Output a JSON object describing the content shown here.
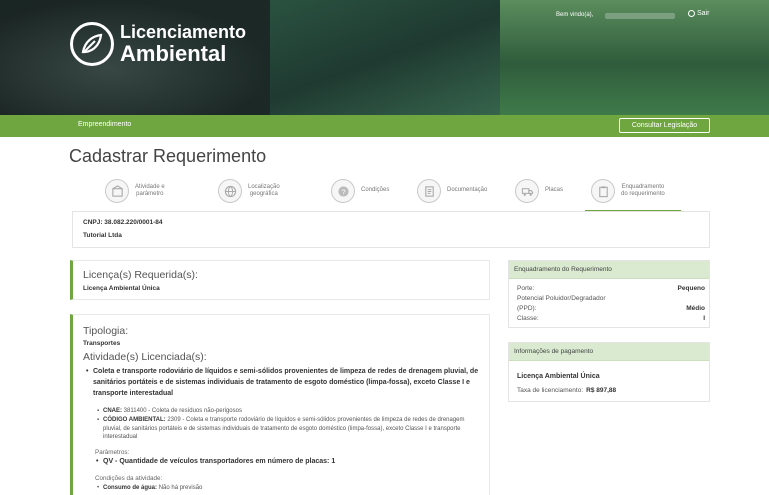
{
  "header": {
    "brand_line1": "Licenciamento",
    "brand_line2": "Ambiental",
    "welcome": "Bem vindo(a),",
    "logout": "Sair"
  },
  "nav": {
    "item": "Empreendimento",
    "consult_button": "Consultar Legislação"
  },
  "page_title": "Cadastrar Requerimento",
  "steps": [
    {
      "l1": "Atividade e",
      "l2": "parâmetro",
      "icon": "box-icon"
    },
    {
      "l1": "Localização",
      "l2": "geográfica",
      "icon": "globe-icon"
    },
    {
      "l1": "Condições",
      "l2": "",
      "icon": "question-icon"
    },
    {
      "l1": "Documentação",
      "l2": "",
      "icon": "document-icon"
    },
    {
      "l1": "Placas",
      "l2": "",
      "icon": "truck-icon"
    },
    {
      "l1": "Enquadramento",
      "l2": "do requerimento",
      "icon": "clipboard-icon"
    }
  ],
  "company": {
    "cnpj": "CNPJ: 38.082.220/0001-84",
    "name": "Tutorial Ltda"
  },
  "licenca": {
    "heading": "Licença(s) Requerida(s):",
    "value": "Licença Ambiental Única"
  },
  "tipologia": {
    "heading": "Tipologia:",
    "value": "Transportes",
    "activities_heading": "Atividade(s) Licenciada(s):",
    "activity": "Coleta e transporte rodoviário de líquidos e semi-sólidos provenientes de limpeza de redes de drenagem pluvial, de sanitários portáteis e de sistemas individuais de tratamento de esgoto doméstico (limpa-fossa), exceto Classe I e transporte interestadual",
    "cnae_label": "CNAE:",
    "cnae_value": "3811400 - Coleta de resíduos não-perigosos",
    "codigo_label": "CÓDIGO AMBIENTAL:",
    "codigo_value": "2309 - Coleta e transporte rodoviário de líquidos e semi-sólidos provenientes de limpeza de redes de drenagem pluvial, de sanitários portáteis e de sistemas individuais de tratamento de esgoto doméstico (limpa-fossa), exceto Classe I e transporte interestadual",
    "params_label": "Parâmetros:",
    "param": "QV - Quantidade de veículos transportadores em número de placas: 1",
    "conditions_label": "Condições da atividade:",
    "water_label": "Consumo de água:",
    "water_value": "Não há previsão"
  },
  "enquadramento": {
    "heading": "Enquadramento do Requerimento",
    "porte_label": "Porte:",
    "porte_value": "Pequeno",
    "ppd_label1": "Potencial Poluidor/Degradador",
    "ppd_label2": "(PPD):",
    "ppd_value": "Médio",
    "classe_label": "Classe:",
    "classe_value": "I"
  },
  "pagamento": {
    "heading": "Informações de pagamento",
    "licenca": "Licença Ambiental Única",
    "taxa_label": "Taxa de licenciamento:",
    "taxa_value": "R$ 897,88"
  },
  "colors": {
    "accent": "#6fa640",
    "panel_head": "#d9ead0"
  }
}
